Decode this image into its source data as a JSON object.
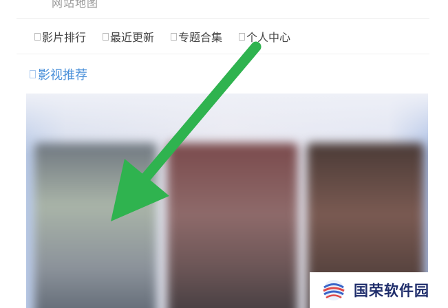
{
  "top_link_partial": "网站地图",
  "nav": {
    "items": [
      {
        "label": "影片排行"
      },
      {
        "label": "最近更新"
      },
      {
        "label": "专题合集"
      },
      {
        "label": "个人中心"
      }
    ]
  },
  "section": {
    "title": "影视推荐"
  },
  "watermark": {
    "text": "国荣软件园",
    "logo_icon": "globe-logo-icon"
  },
  "colors": {
    "arrow": "#2fb34f",
    "section_title": "#4a90d9",
    "watermark_text": "#1f2d6b"
  }
}
